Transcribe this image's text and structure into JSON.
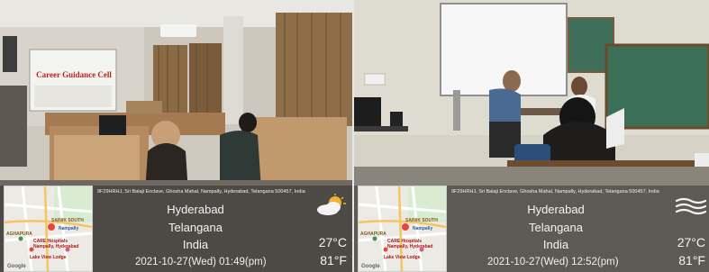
{
  "photos": [
    {
      "address": "9F29HRHJ, Sri Balaji Enclave, Ghosha Mahal, Nampally, Hyderabad, Telangana 500457, India",
      "city": "Hyderabad",
      "state": "Telangana",
      "country": "India",
      "temp_c": "27°C",
      "temp_f": "81°F",
      "datetime": "2021-10-27(Wed)  01:49(pm)",
      "weather_icon": "partly-cloudy-icon",
      "banner_text": "Career Guidance Cell",
      "map": {
        "labels": [
          "SAINIK SOUTH",
          "Nampally",
          "AGHAPURA",
          "CARE Hospitals Nampally, Hyderabad",
          "Lake View Lodge"
        ],
        "brand": "Google"
      }
    },
    {
      "address": "9F29HRHJ, Sri Balaji Enclave, Ghosha Mahal, Nampally, Hyderabad, Telangana 500457, India",
      "city": "Hyderabad",
      "state": "Telangana",
      "country": "India",
      "temp_c": "27°C",
      "temp_f": "81°F",
      "datetime": "2021-10-27(Wed)  12:52(pm)",
      "weather_icon": "haze-icon",
      "map": {
        "labels": [
          "SAINIK SOUTH",
          "Nampally",
          "AGHAPURA",
          "CARE Hospitals Nampally, Hyderabad",
          "Lake View Lodge"
        ],
        "brand": "Google"
      }
    }
  ]
}
